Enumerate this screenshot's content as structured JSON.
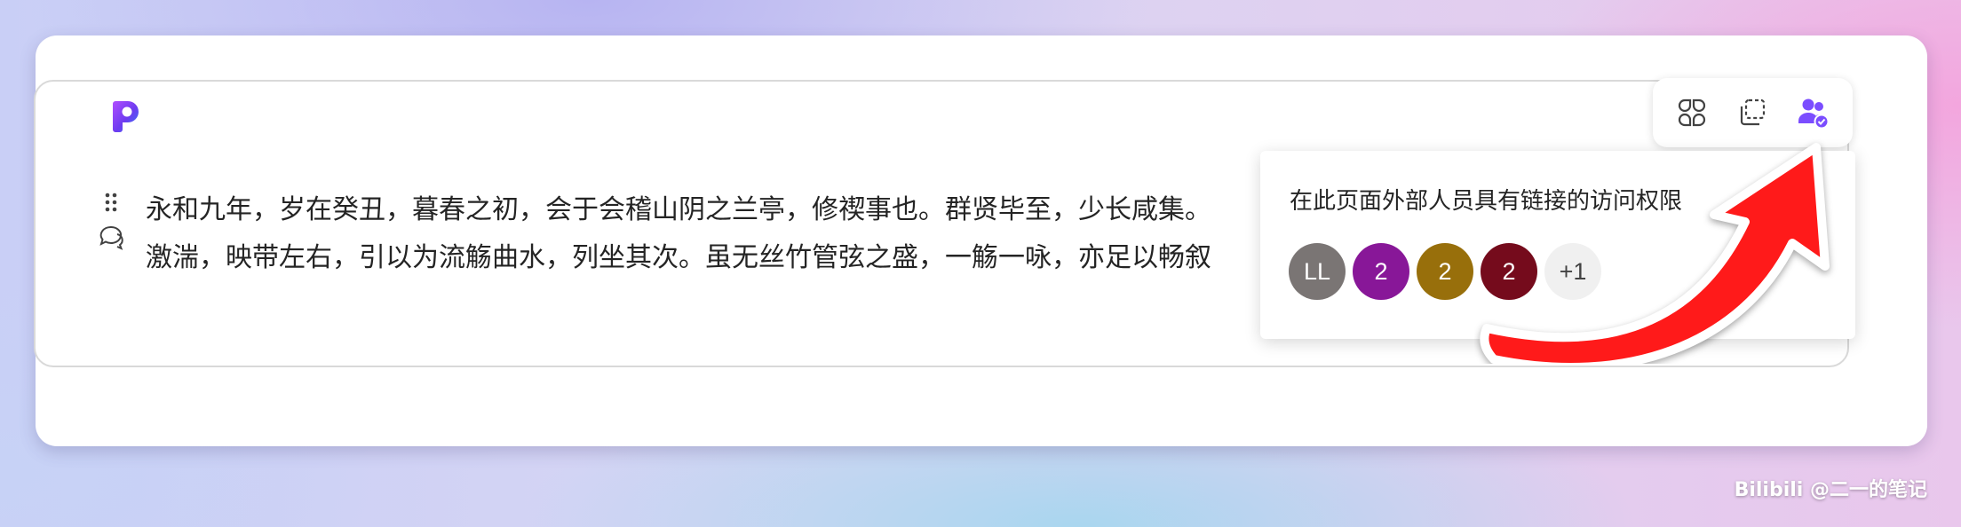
{
  "document": {
    "paragraph_lines": [
      "永和九年，岁在癸丑，暮春之初，会于会稽山阴之兰亭，修禊事也。群贤毕至，少长咸集。",
      "激湍，映带左右，引以为流觞曲水，列坐其次。虽无丝竹管弦之盛，一觞一咏，亦足以畅叙"
    ]
  },
  "toolbar": {
    "buttons": [
      {
        "icon": "loop-components-icon"
      },
      {
        "icon": "copy-component-icon"
      },
      {
        "icon": "shared-with-people-icon"
      }
    ]
  },
  "share_popup": {
    "title": "在此页面外部人员具有链接的访问权限",
    "avatars": [
      {
        "label": "LL",
        "color": "#7a7574"
      },
      {
        "label": "2",
        "color": "#881798"
      },
      {
        "label": "2",
        "color": "#986f0b"
      },
      {
        "label": "2",
        "color": "#750b1c"
      },
      {
        "label": "+1",
        "color": "#f0f0f0"
      }
    ]
  },
  "watermark": "Bilibili @二一的笔记",
  "colors": {
    "accent_purple": "#7b4dff",
    "arrow_red": "#ff1a1a"
  }
}
